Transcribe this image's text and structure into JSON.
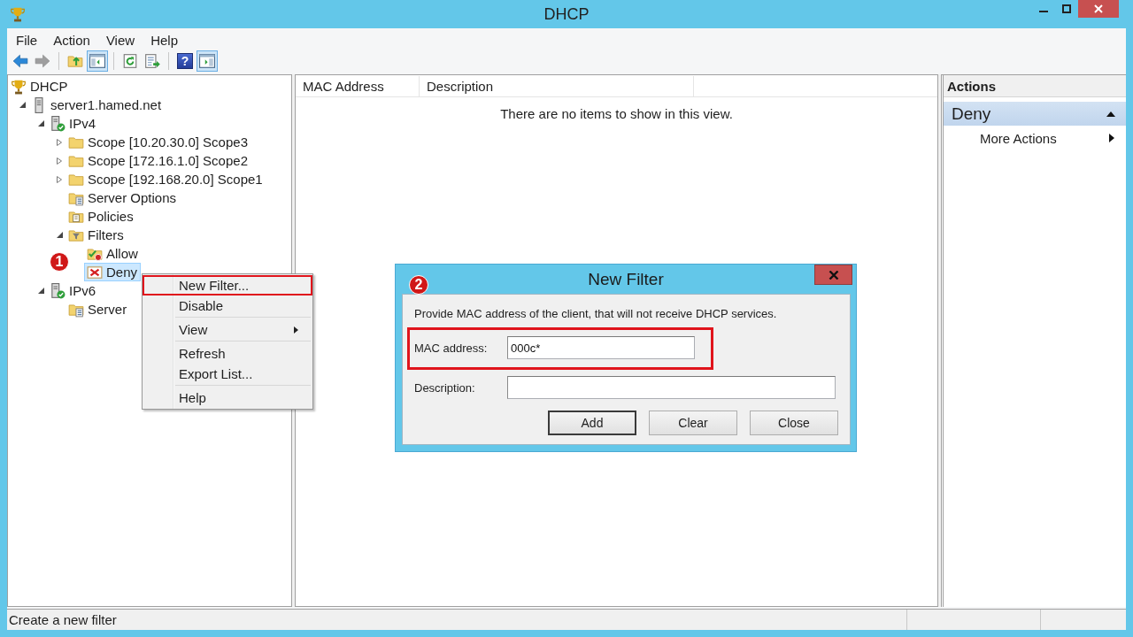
{
  "window": {
    "title": "DHCP"
  },
  "menu_bar": [
    "File",
    "Action",
    "View",
    "Help"
  ],
  "toolbar": [
    [
      {
        "kind": "back",
        "disabled": false,
        "pressed": false
      },
      {
        "kind": "forward",
        "disabled": true,
        "pressed": false
      }
    ],
    [
      {
        "kind": "folder_up",
        "disabled": false,
        "pressed": false
      },
      {
        "kind": "console_tree",
        "disabled": false,
        "pressed": true
      }
    ],
    [
      {
        "kind": "refresh",
        "disabled": false,
        "pressed": false
      },
      {
        "kind": "export",
        "disabled": false,
        "pressed": false
      }
    ],
    [
      {
        "kind": "help",
        "glyph": "?",
        "disabled": false,
        "pressed": false
      },
      {
        "kind": "action_pane",
        "disabled": false,
        "pressed": true
      }
    ]
  ],
  "tree": [
    {
      "label": "DHCP",
      "kind": "root",
      "selected": false,
      "children": [
        {
          "label": "server1.hamed.net",
          "kind": "server",
          "expanded": true,
          "selected": false,
          "children": [
            {
              "label": "IPv4",
              "kind": "protocol",
              "expanded": true,
              "selected": false,
              "children": [
                {
                  "label": "Scope [10.20.30.0] Scope3",
                  "kind": "scope",
                  "expanded": false,
                  "selected": false
                },
                {
                  "label": "Scope [172.16.1.0] Scope2",
                  "kind": "scope",
                  "expanded": false,
                  "selected": false
                },
                {
                  "label": "Scope [192.168.20.0] Scope1",
                  "kind": "scope",
                  "expanded": false,
                  "selected": false
                },
                {
                  "label": "Server Options",
                  "kind": "options",
                  "selected": false
                },
                {
                  "label": "Policies",
                  "kind": "policies",
                  "selected": false
                },
                {
                  "label": "Filters",
                  "kind": "filters",
                  "expanded": true,
                  "selected": false,
                  "children": [
                    {
                      "label": "Allow",
                      "kind": "allow",
                      "selected": false
                    },
                    {
                      "label": "Deny",
                      "kind": "deny",
                      "selected": true,
                      "marker": "1"
                    }
                  ]
                }
              ]
            },
            {
              "label": "IPv6",
              "kind": "protocol",
              "expanded": true,
              "selected": false,
              "children": [
                {
                  "label": "Server",
                  "kind": "options",
                  "selected": false
                }
              ]
            }
          ]
        }
      ]
    }
  ],
  "list_view": {
    "columns": [
      "MAC Address",
      "Description"
    ],
    "empty_message": "There are no items to show in this view."
  },
  "actions_pane": {
    "title": "Actions",
    "sections": [
      {
        "title": "Deny",
        "expanded": true,
        "items": [
          {
            "label": "More Actions",
            "submenu": true
          }
        ]
      }
    ]
  },
  "context_menu": {
    "groups": [
      [
        {
          "label": "New Filter...",
          "submenu": false,
          "highlighted": true
        },
        {
          "label": "Disable",
          "submenu": false,
          "highlighted": false
        }
      ],
      [
        {
          "label": "View",
          "submenu": true,
          "highlighted": false
        }
      ],
      [
        {
          "label": "Refresh",
          "submenu": false,
          "highlighted": false
        },
        {
          "label": "Export List...",
          "submenu": false,
          "highlighted": false
        }
      ],
      [
        {
          "label": "Help",
          "submenu": false,
          "highlighted": false
        }
      ]
    ]
  },
  "dialog": {
    "title": "New Filter",
    "marker": "2",
    "message": "Provide MAC address of the client, that will not receive DHCP services.",
    "fields": [
      {
        "label": "MAC address:",
        "value": "000c*",
        "highlighted": true
      },
      {
        "label": "Description:",
        "highlighted": false
      }
    ],
    "buttons": [
      {
        "label": "Add",
        "default": true
      },
      {
        "label": "Clear",
        "default": false
      },
      {
        "label": "Close",
        "default": false
      }
    ]
  },
  "status_bar": {
    "text": "Create a new filter"
  }
}
